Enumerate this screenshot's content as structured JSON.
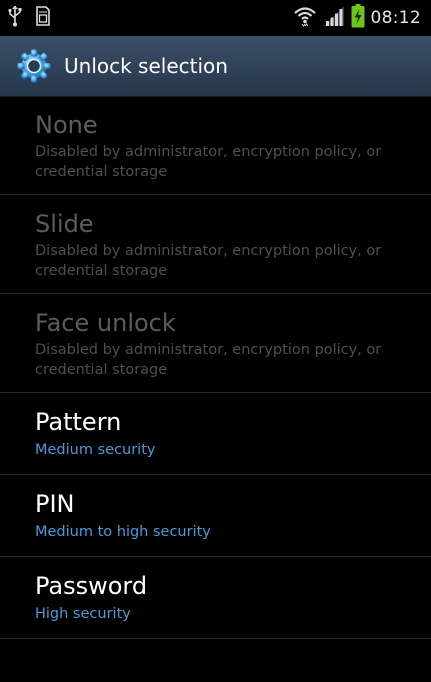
{
  "status_bar": {
    "icons": [
      "usb-icon",
      "sd-card-icon",
      "wifi-icon",
      "signal-icon",
      "battery-charging-icon"
    ],
    "time": "08:12"
  },
  "header": {
    "icon": "gear-icon",
    "title": "Unlock selection"
  },
  "colors": {
    "header_top": "#3a4f68",
    "header_bottom": "#26364b",
    "accent_blue": "#4c9ad8",
    "battery_green": "#6cc41c",
    "disabled_text": "#5c5c5c"
  },
  "options": [
    {
      "title": "None",
      "subtitle": "Disabled by administrator, encryption policy, or credential storage",
      "enabled": false
    },
    {
      "title": "Slide",
      "subtitle": "Disabled by administrator, encryption policy, or credential storage",
      "enabled": false
    },
    {
      "title": "Face unlock",
      "subtitle": "Disabled by administrator, encryption policy, or credential storage",
      "enabled": false
    },
    {
      "title": "Pattern",
      "subtitle": "Medium security",
      "enabled": true
    },
    {
      "title": "PIN",
      "subtitle": "Medium to high security",
      "enabled": true
    },
    {
      "title": "Password",
      "subtitle": "High security",
      "enabled": true
    }
  ]
}
